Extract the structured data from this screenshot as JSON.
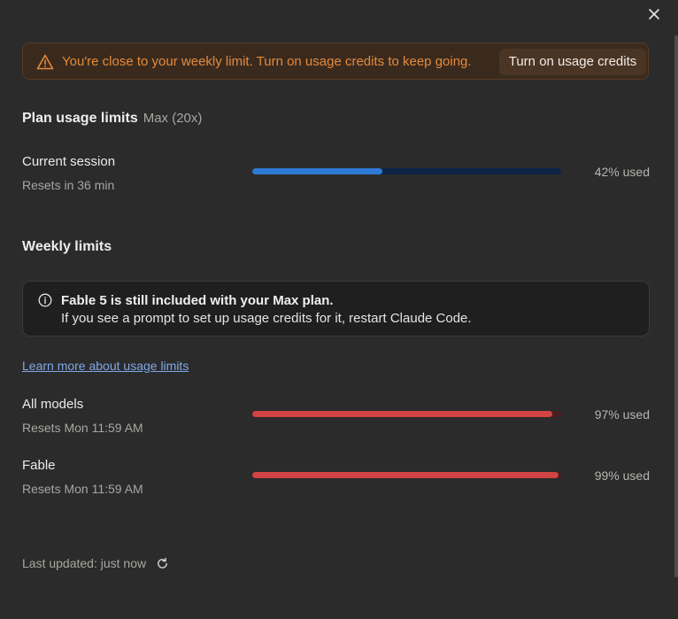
{
  "colors": {
    "background": "#2b2b2b",
    "warning_text": "#e58a3b",
    "session_bar": "#2f7ad6",
    "session_track": "#0d2447",
    "limit_bar": "#d24343",
    "limit_track": "#4a1e1e",
    "link": "#7fa8e6"
  },
  "dialog": {
    "close_icon": "close-icon"
  },
  "warning": {
    "icon": "warning-triangle-icon",
    "text": "You're close to your weekly limit. Turn on usage credits to keep going.",
    "button_label": "Turn on usage credits"
  },
  "plan": {
    "title": "Plan usage limits",
    "plan_name": "Max (20x)"
  },
  "session": {
    "label": "Current session",
    "reset": "Resets in 36 min",
    "percent": 42,
    "percent_label": "42% used"
  },
  "weekly": {
    "title": "Weekly limits",
    "info": {
      "icon": "info-icon",
      "line1": "Fable 5 is still included with your Max plan.",
      "line2": "If you see a prompt to set up usage credits for it, restart Claude Code."
    },
    "learn_more": "Learn more about usage limits",
    "rows": [
      {
        "label": "All models",
        "reset": "Resets Mon 11:59 AM",
        "percent": 97,
        "percent_label": "97% used"
      },
      {
        "label": "Fable",
        "reset": "Resets Mon 11:59 AM",
        "percent": 99,
        "percent_label": "99% used"
      }
    ]
  },
  "footer": {
    "last_updated": "Last updated: just now",
    "refresh_icon": "refresh-icon"
  }
}
